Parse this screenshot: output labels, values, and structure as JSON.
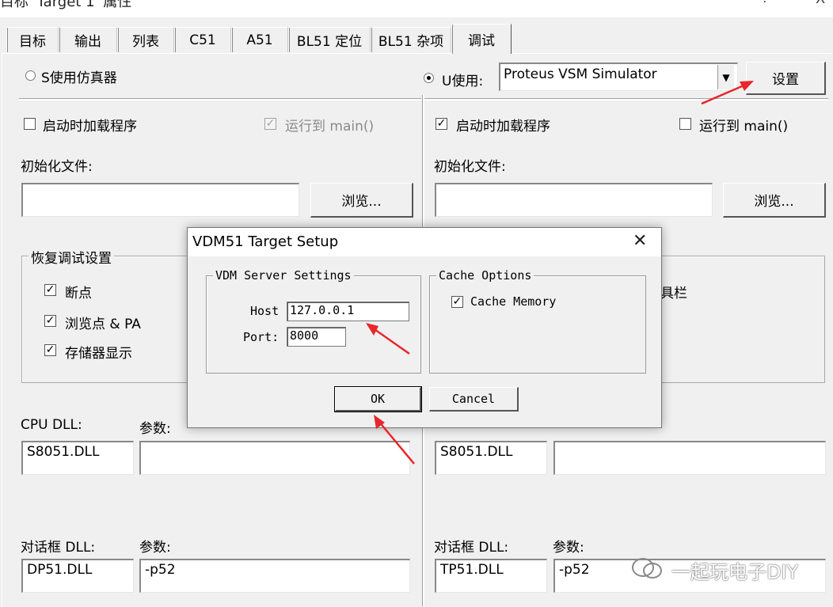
{
  "window": {
    "title": "目标 'Target 1' 属性",
    "help": "?",
    "close": "X"
  },
  "tabs": [
    {
      "label": "目标"
    },
    {
      "label": "输出"
    },
    {
      "label": "列表"
    },
    {
      "label": "C51"
    },
    {
      "label": "A51"
    },
    {
      "label": "BL51 定位"
    },
    {
      "label": "BL51 杂项"
    },
    {
      "label": "调试"
    }
  ],
  "left": {
    "radio_label": "S使用仿真器",
    "load_app": "启动时加载程序",
    "run_main": "运行到 main()",
    "init_file": "初始化文件:",
    "browse": "浏览...",
    "restore_legend": "恢复调试设置",
    "breakpoints": "断点",
    "watch": "浏览点 & PA",
    "memory": "存储器显示",
    "cpu_dll_label": "CPU DLL:",
    "param_label": "参数:",
    "cpu_dll": "S8051.DLL",
    "cpu_param": "",
    "dlg_dll_label": "对话框 DLL:",
    "dlg_param_label": "参数:",
    "dlg_dll": "DP51.DLL",
    "dlg_param": "-p52"
  },
  "right": {
    "radio_label": "U使用:",
    "driver": "Proteus VSM Simulator",
    "settings": "设置",
    "load_app": "启动时加载程序",
    "run_main": "运行到 main()",
    "init_file": "初始化文件:",
    "browse": "浏览...",
    "toolbar_partial": "具栏",
    "cpu_dll": "S8051.DLL",
    "cpu_param": "",
    "dlg_dll_label": "对话框 DLL:",
    "dlg_param_label": "参数:",
    "dlg_dll": "TP51.DLL",
    "dlg_param": "-p52"
  },
  "dialog": {
    "title": "VDM51 Target Setup",
    "close": "✕",
    "server_legend": "VDM Server Settings",
    "host_label": "Host",
    "host": "127.0.0.1",
    "port_label": "Port:",
    "port": "8000",
    "cache_legend": "Cache Options",
    "cache_memory": "Cache Memory",
    "ok": "OK",
    "cancel": "Cancel"
  },
  "watermark": "一起玩电子DIY",
  "colors": {
    "arrow": "#e8262b"
  }
}
